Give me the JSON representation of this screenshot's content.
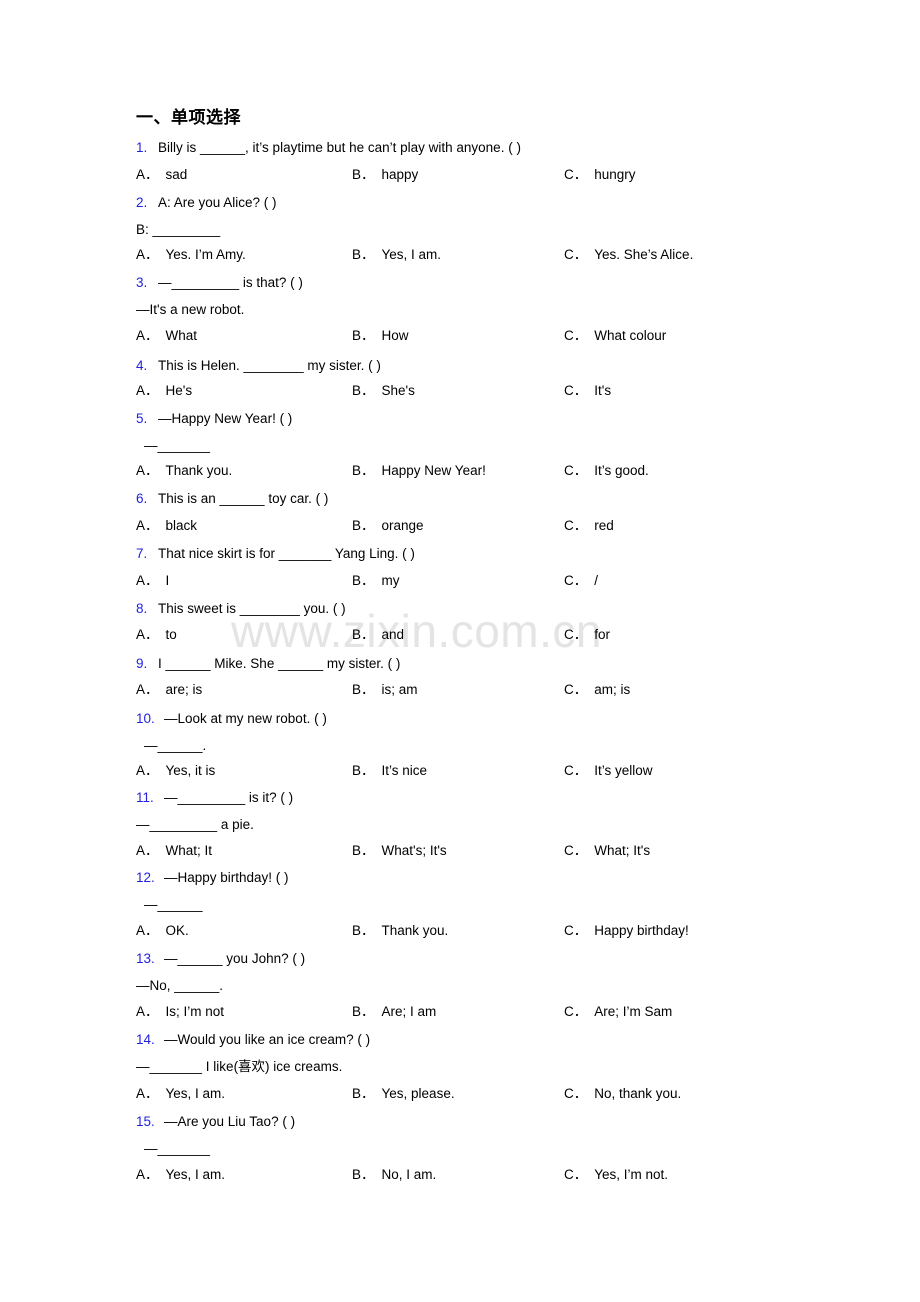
{
  "document": {
    "section_title": "一、单项选择",
    "watermark": "www.zixin.com.cn",
    "number_color": "#2222dd",
    "text_color": "#000000"
  },
  "questions": [
    {
      "num": "1.",
      "stem": "Billy is ______, it’s playtime but he can’t play with anyone. (   )",
      "sub": null,
      "a": "sad",
      "b": "happy",
      "c": "hungry"
    },
    {
      "num": "2.",
      "stem": "A: Are you Alice?  (     )",
      "sub": "B: _________",
      "a": "Yes. I’m Amy.",
      "b": "Yes, I am.",
      "c": "Yes. She’s Alice."
    },
    {
      "num": "3.",
      "stem": "—_________ is that? (  )",
      "sub": "—It's a new robot.",
      "a": "What",
      "b": "How",
      "c": "What colour"
    },
    {
      "num": "4.",
      "stem": "This is Helen. ________ my sister. (  )",
      "sub": null,
      "a": "He's",
      "b": "She's",
      "c": "It's"
    },
    {
      "num": "5.",
      "stem": "—Happy New Year! (   )",
      "sub": "—_______",
      "a": "Thank you.",
      "b": "Happy New Year!",
      "c": "It’s good."
    },
    {
      "num": "6.",
      "stem": "This is an ______ toy car. (  )",
      "sub": null,
      "a": "black",
      "b": "orange",
      "c": "red"
    },
    {
      "num": "7.",
      "stem": "That nice skirt is for _______ Yang Ling. (  )",
      "sub": null,
      "a": "I",
      "b": "my",
      "c": "/"
    },
    {
      "num": "8.",
      "stem": "This sweet is ________ you. (    )",
      "sub": null,
      "a": "to",
      "b": "and",
      "c": "for"
    },
    {
      "num": "9.",
      "stem": "I ______ Mike. She ______ my sister. (   )",
      "sub": null,
      "a": "are; is",
      "b": "is; am",
      "c": "am; is"
    },
    {
      "num": "10.",
      "stem": "—Look at my new robot. (   )",
      "sub": "—______.",
      "a": "Yes, it is",
      "b": "It’s nice",
      "c": "It’s yellow"
    },
    {
      "num": "11.",
      "stem": "—_________ is it? ( )",
      "sub": "—_________ a pie.",
      "a": "What; It",
      "b": "What's; It's",
      "c": "What; It's"
    },
    {
      "num": "12.",
      "stem": "—Happy birthday! ( )",
      "sub": "—______",
      "a": "OK.",
      "b": "Thank you.",
      "c": "Happy birthday!"
    },
    {
      "num": "13.",
      "stem": "—______ you John? (   )",
      "sub": "—No, ______.",
      "a": "Is; I’m not",
      "b": "Are; I am",
      "c": "Are; I’m Sam"
    },
    {
      "num": "14.",
      "stem": "—Would you like an ice cream? (   )",
      "sub": "—_______ I like(喜欢) ice creams.",
      "a": "Yes, I am.",
      "b": "Yes, please.",
      "c": "No, thank you."
    },
    {
      "num": "15.",
      "stem": "—Are you Liu Tao? (   )",
      "sub": "—_______",
      "a": "Yes, I am.",
      "b": "No, I am.",
      "c": "Yes, I’m not."
    }
  ]
}
